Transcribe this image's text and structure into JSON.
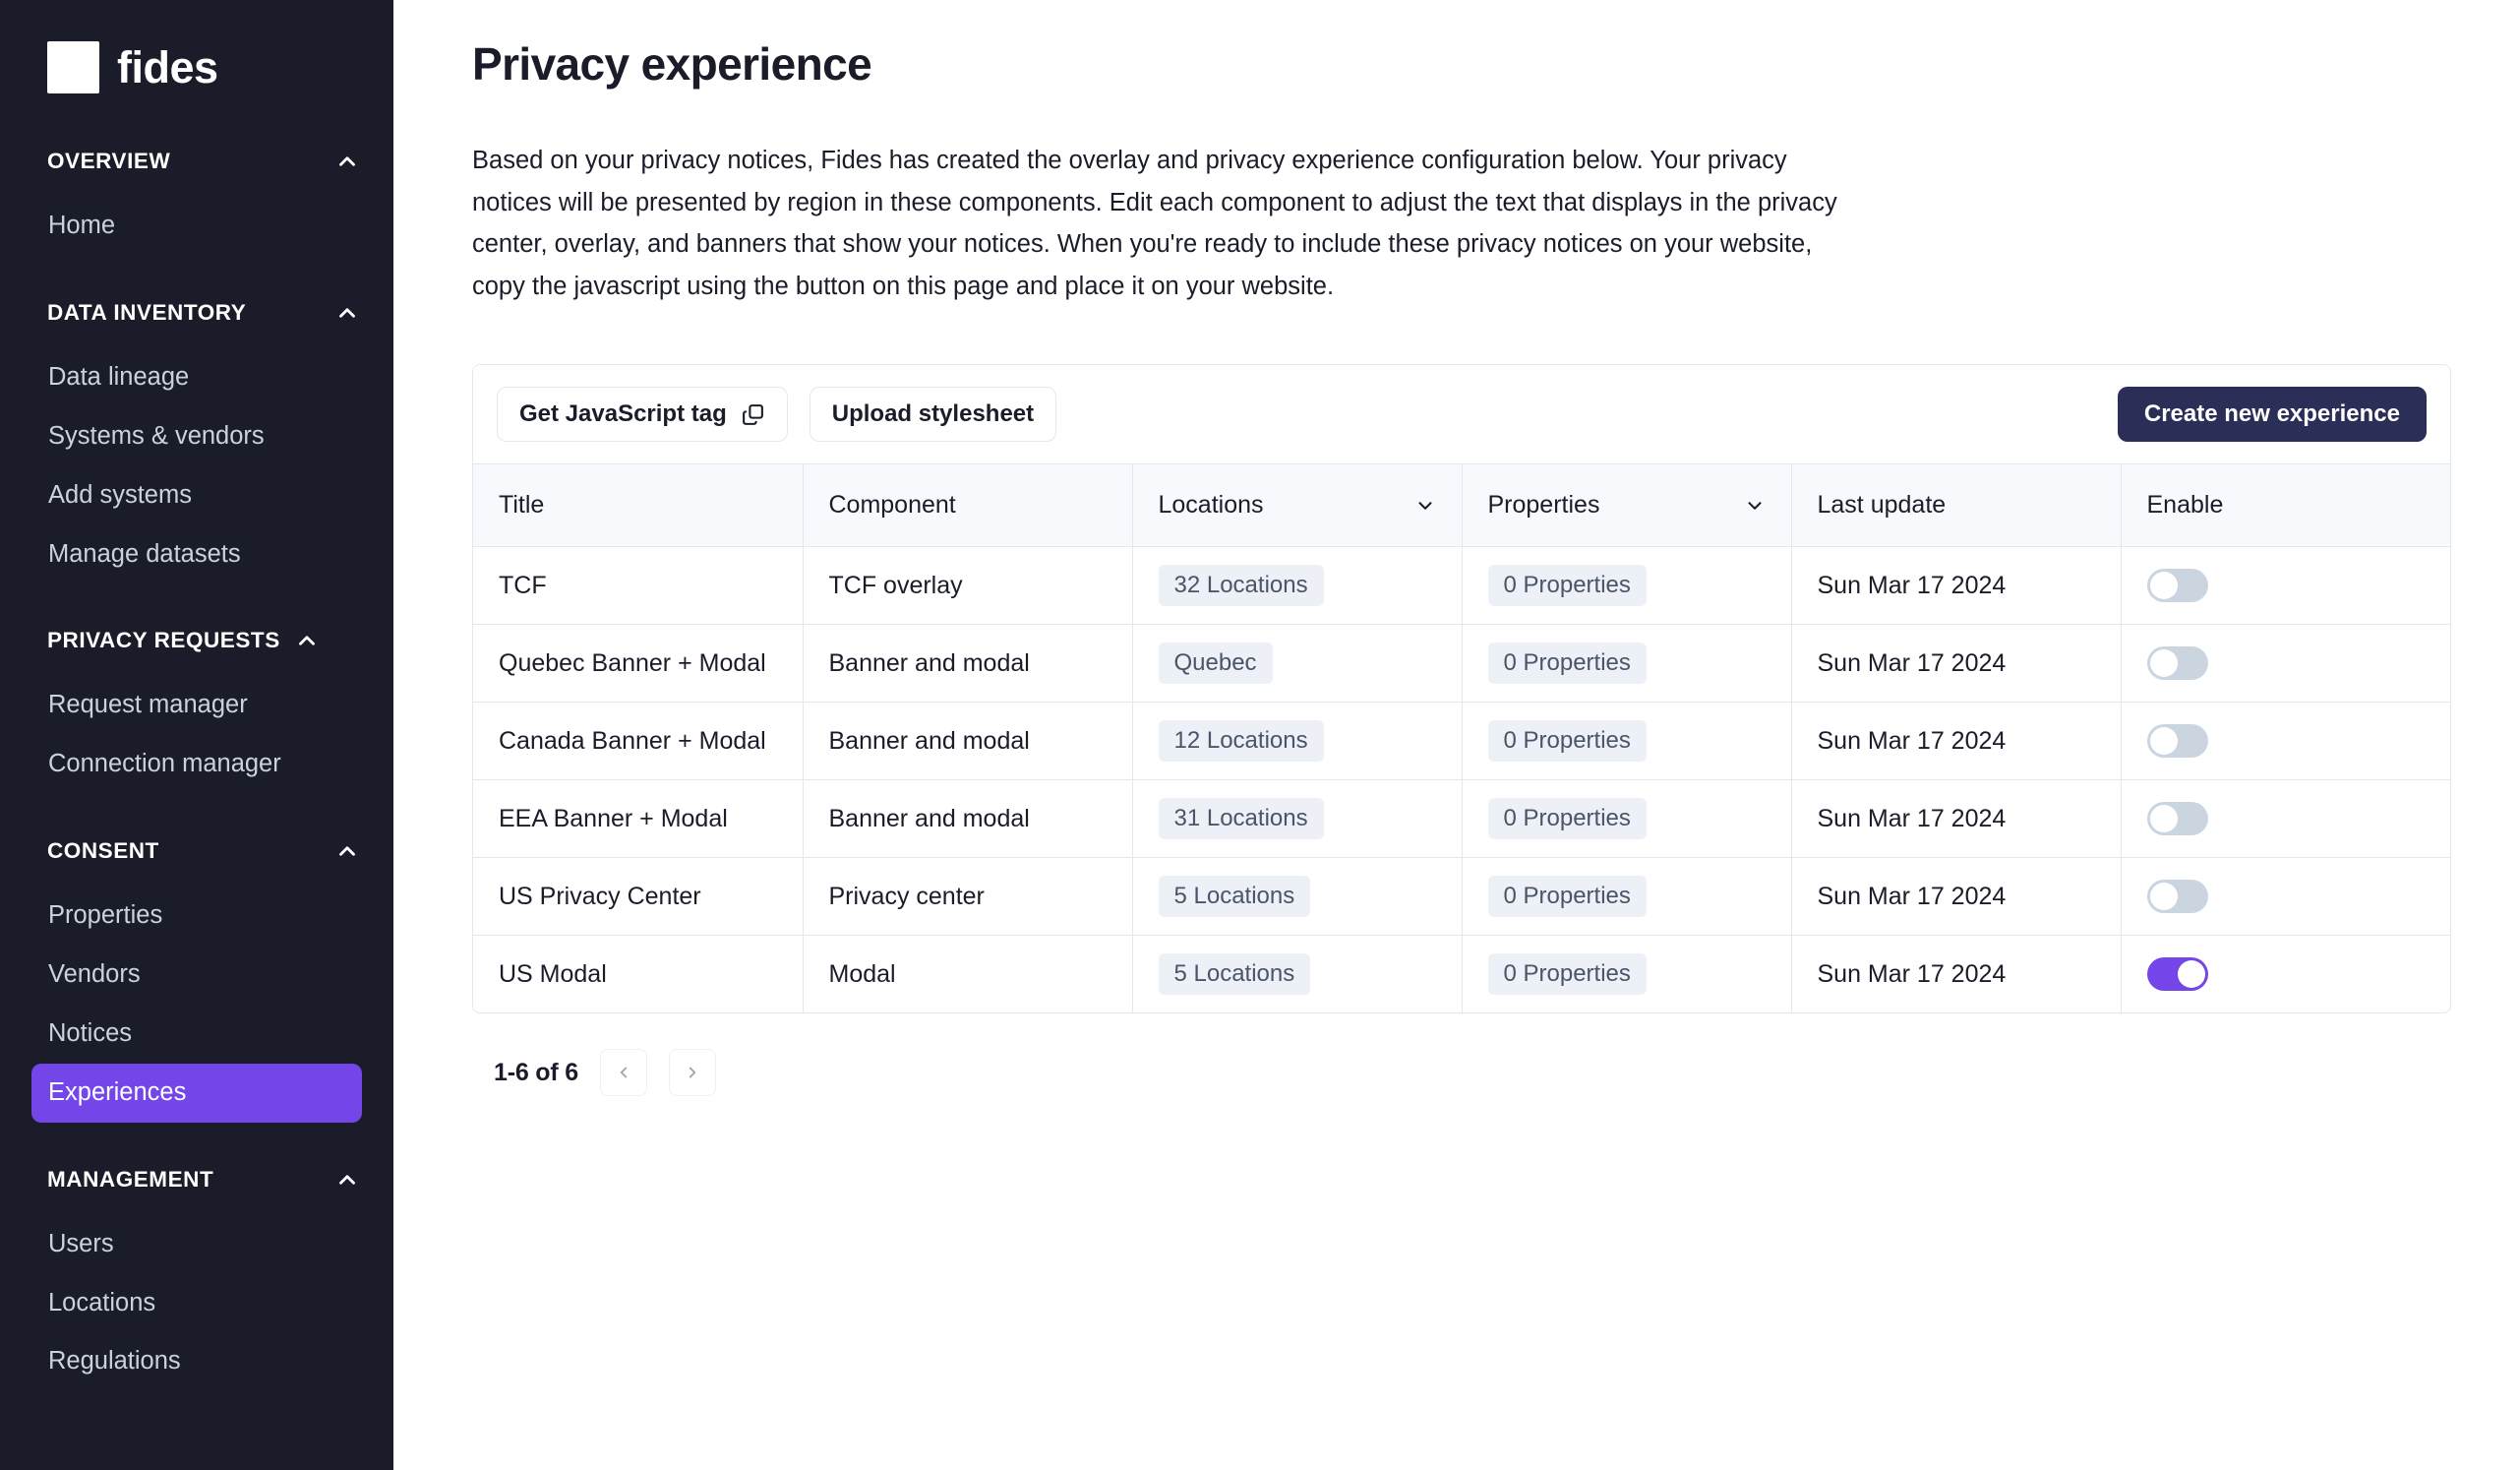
{
  "brand": {
    "name": "fides",
    "mark_icon": "fides-logo-square"
  },
  "sidebar": {
    "sections": [
      {
        "title": "OVERVIEW",
        "collapse_icon": "chevron-up-icon",
        "items": [
          {
            "label": "Home",
            "active": false
          }
        ]
      },
      {
        "title": "DATA INVENTORY",
        "collapse_icon": "chevron-up-icon",
        "items": [
          {
            "label": "Data lineage",
            "active": false
          },
          {
            "label": "Systems & vendors",
            "active": false
          },
          {
            "label": "Add systems",
            "active": false
          },
          {
            "label": "Manage datasets",
            "active": false
          }
        ]
      },
      {
        "title": "PRIVACY REQUESTS",
        "collapse_icon": "chevron-up-icon",
        "items": [
          {
            "label": "Request manager",
            "active": false
          },
          {
            "label": "Connection manager",
            "active": false
          }
        ]
      },
      {
        "title": "CONSENT",
        "collapse_icon": "chevron-up-icon",
        "items": [
          {
            "label": "Properties",
            "active": false
          },
          {
            "label": "Vendors",
            "active": false
          },
          {
            "label": "Notices",
            "active": false
          },
          {
            "label": "Experiences",
            "active": true
          }
        ]
      },
      {
        "title": "MANAGEMENT",
        "collapse_icon": "chevron-up-icon",
        "items": [
          {
            "label": "Users",
            "active": false
          },
          {
            "label": "Locations",
            "active": false
          },
          {
            "label": "Regulations",
            "active": false
          }
        ]
      }
    ]
  },
  "page": {
    "title": "Privacy experience",
    "description": "Based on your privacy notices, Fides has created the overlay and privacy experience configuration below. Your privacy notices will be presented by region in these components. Edit each component to adjust the text that displays in the privacy center, overlay, and banners that show your notices. When you're ready to include these privacy notices on your website, copy the javascript using the button on this page and place it on your website."
  },
  "toolbar": {
    "get_js_tag_label": "Get JavaScript tag",
    "get_js_tag_icon": "copy-icon",
    "upload_stylesheet_label": "Upload stylesheet",
    "create_new_label": "Create new experience"
  },
  "table": {
    "columns": [
      {
        "label": "Title",
        "sortable": false
      },
      {
        "label": "Component",
        "sortable": false
      },
      {
        "label": "Locations",
        "sortable": true,
        "icon": "chevron-down-icon"
      },
      {
        "label": "Properties",
        "sortable": true,
        "icon": "chevron-down-icon"
      },
      {
        "label": "Last update",
        "sortable": false
      },
      {
        "label": "Enable",
        "sortable": false
      }
    ],
    "rows": [
      {
        "title": "TCF",
        "component": "TCF overlay",
        "locations": "32 Locations",
        "properties": "0 Properties",
        "last_update": "Sun Mar 17 2024",
        "enabled": false
      },
      {
        "title": "Quebec Banner + Modal",
        "component": "Banner and modal",
        "locations": "Quebec",
        "properties": "0 Properties",
        "last_update": "Sun Mar 17 2024",
        "enabled": false
      },
      {
        "title": "Canada Banner + Modal",
        "component": "Banner and modal",
        "locations": "12 Locations",
        "properties": "0 Properties",
        "last_update": "Sun Mar 17 2024",
        "enabled": false
      },
      {
        "title": "EEA Banner + Modal",
        "component": "Banner and modal",
        "locations": "31 Locations",
        "properties": "0 Properties",
        "last_update": "Sun Mar 17 2024",
        "enabled": false
      },
      {
        "title": "US Privacy Center",
        "component": "Privacy center",
        "locations": "5 Locations",
        "properties": "0 Properties",
        "last_update": "Sun Mar 17 2024",
        "enabled": false
      },
      {
        "title": "US Modal",
        "component": "Modal",
        "locations": "5 Locations",
        "properties": "0 Properties",
        "last_update": "Sun Mar 17 2024",
        "enabled": true
      }
    ]
  },
  "pagination": {
    "range_label": "1-6 of 6",
    "prev_icon": "chevron-left-icon",
    "next_icon": "chevron-right-icon"
  },
  "colors": {
    "sidebar_bg": "#1A1D29",
    "accent_purple": "#7445E8",
    "primary_button_bg": "#2B2E56",
    "badge_bg": "#EDF0F7",
    "table_header_bg": "#F7F9FC",
    "border": "#E2E8F0"
  }
}
